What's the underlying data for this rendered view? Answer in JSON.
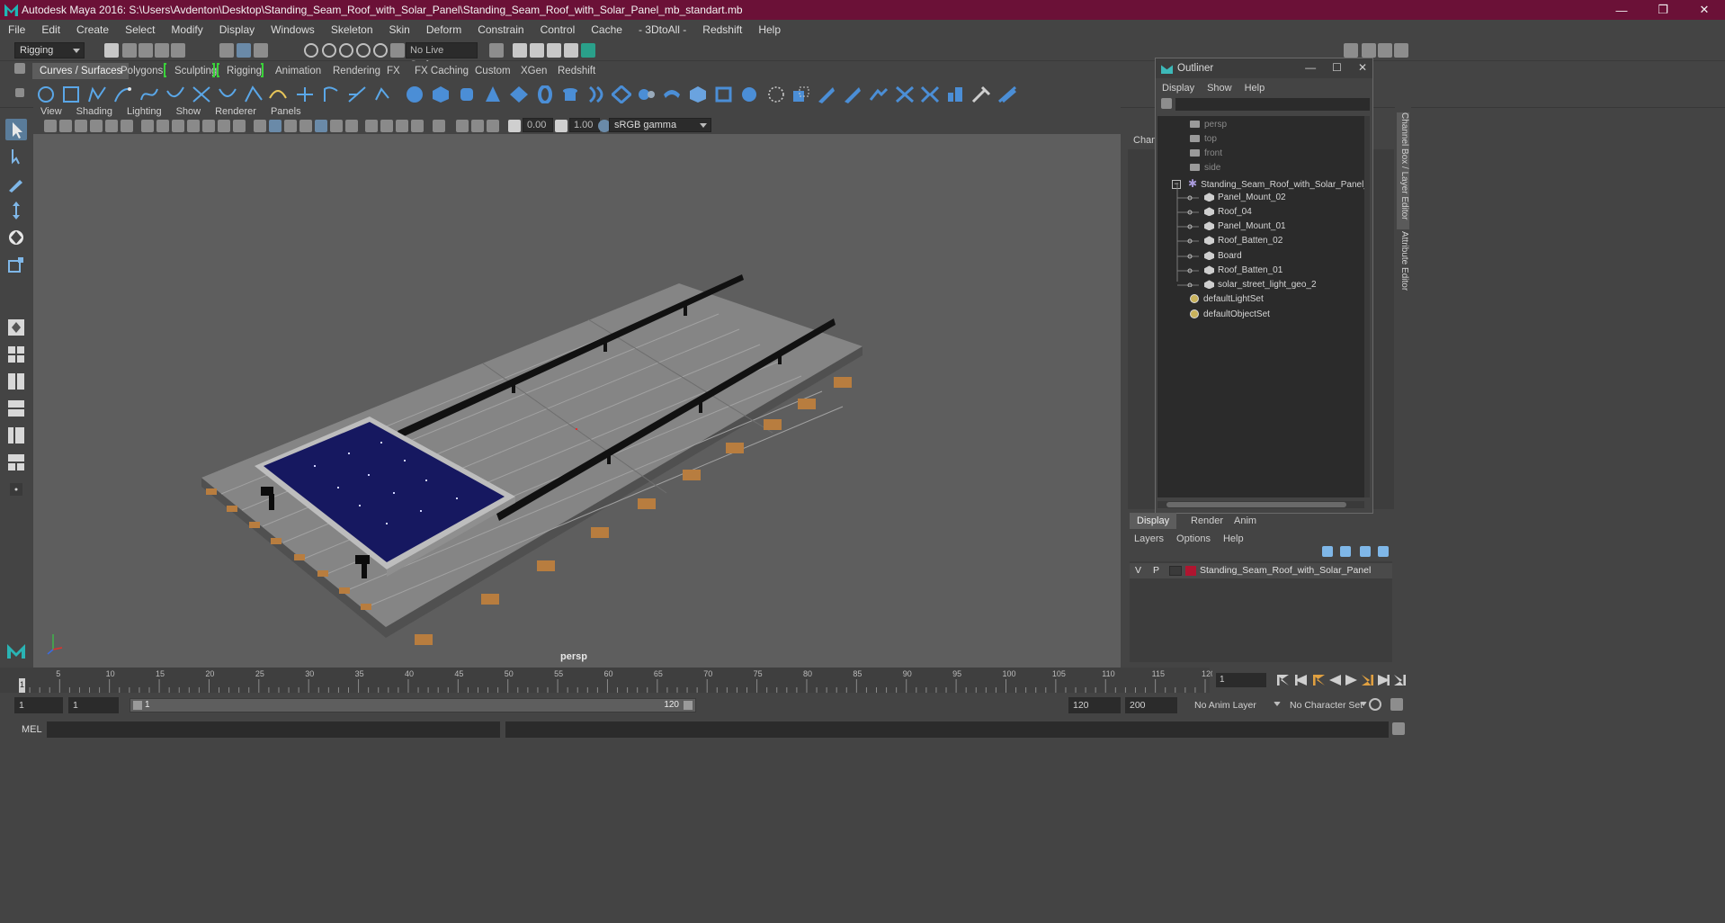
{
  "window": {
    "title": "Autodesk Maya 2016: S:\\Users\\Avdenton\\Desktop\\Standing_Seam_Roof_with_Solar_Panel\\Standing_Seam_Roof_with_Solar_Panel_mb_standart.mb",
    "minimize": "—",
    "maximize": "❐",
    "close": "✕"
  },
  "menubar": [
    "File",
    "Edit",
    "Create",
    "Select",
    "Modify",
    "Display",
    "Windows",
    "Skeleton",
    "Skin",
    "Deform",
    "Constrain",
    "Control",
    "Cache",
    "- 3DtoAll -",
    "Redshift",
    "Help"
  ],
  "statusline": {
    "mode": "Rigging",
    "live_surface": "No Live Surface"
  },
  "shelf": {
    "tabs": [
      "Curves / Surfaces",
      "Polygons",
      "Sculpting",
      "Rigging",
      "Animation",
      "Rendering",
      "FX",
      "FX Caching",
      "Custom",
      "XGen",
      "Redshift"
    ],
    "active_tab": "Curves / Surfaces"
  },
  "viewport": {
    "menu": [
      "View",
      "Shading",
      "Lighting",
      "Show",
      "Renderer",
      "Panels"
    ],
    "exposure": "0.00",
    "gamma": "1.00",
    "color_space": "sRGB gamma",
    "camera_label": "persp"
  },
  "outliner": {
    "title": "Outliner",
    "menu": [
      "Display",
      "Show",
      "Help"
    ],
    "items": [
      {
        "label": "persp",
        "kind": "camera",
        "depth": 0
      },
      {
        "label": "top",
        "kind": "camera",
        "depth": 0
      },
      {
        "label": "front",
        "kind": "camera",
        "depth": 0
      },
      {
        "label": "side",
        "kind": "camera",
        "depth": 0
      },
      {
        "label": "Standing_Seam_Roof_with_Solar_Panel_nc",
        "kind": "group",
        "depth": 0
      },
      {
        "label": "Panel_Mount_02",
        "kind": "mesh",
        "depth": 1
      },
      {
        "label": "Roof_04",
        "kind": "mesh",
        "depth": 1
      },
      {
        "label": "Panel_Mount_01",
        "kind": "mesh",
        "depth": 1
      },
      {
        "label": "Roof_Batten_02",
        "kind": "mesh",
        "depth": 1
      },
      {
        "label": "Board",
        "kind": "mesh",
        "depth": 1
      },
      {
        "label": "Roof_Batten_01",
        "kind": "mesh",
        "depth": 1
      },
      {
        "label": "solar_street_light_geo_2",
        "kind": "mesh",
        "depth": 1
      },
      {
        "label": "defaultLightSet",
        "kind": "set",
        "depth": 0
      },
      {
        "label": "defaultObjectSet",
        "kind": "set",
        "depth": 0
      }
    ]
  },
  "channel_box": {
    "label": "Chann",
    "side_tabs": [
      "Channel Box / Layer Editor",
      "Attribute Editor"
    ]
  },
  "layer_editor": {
    "tabs": [
      "Display",
      "Render",
      "Anim"
    ],
    "active_tab": "Display",
    "menu": [
      "Layers",
      "Options",
      "Help"
    ],
    "layers": [
      {
        "visible": "V",
        "playback": "P",
        "name": "Standing_Seam_Roof_with_Solar_Panel",
        "color": "#b01530"
      }
    ]
  },
  "timeline": {
    "ticks": [
      5,
      10,
      15,
      20,
      25,
      30,
      35,
      40,
      45,
      50,
      55,
      60,
      65,
      70,
      75,
      80,
      85,
      90,
      95,
      100,
      105,
      110,
      115,
      120
    ],
    "min": 1,
    "max": 120,
    "current_frame": "1",
    "current_field": "1"
  },
  "range": {
    "start": "1",
    "playback_start": "1",
    "bar_start": "1",
    "bar_end": "120",
    "playback_end": "120",
    "end": "200",
    "anim_layer": "No Anim Layer",
    "character_set": "No Character Set"
  },
  "command_line": {
    "label": "MEL"
  }
}
